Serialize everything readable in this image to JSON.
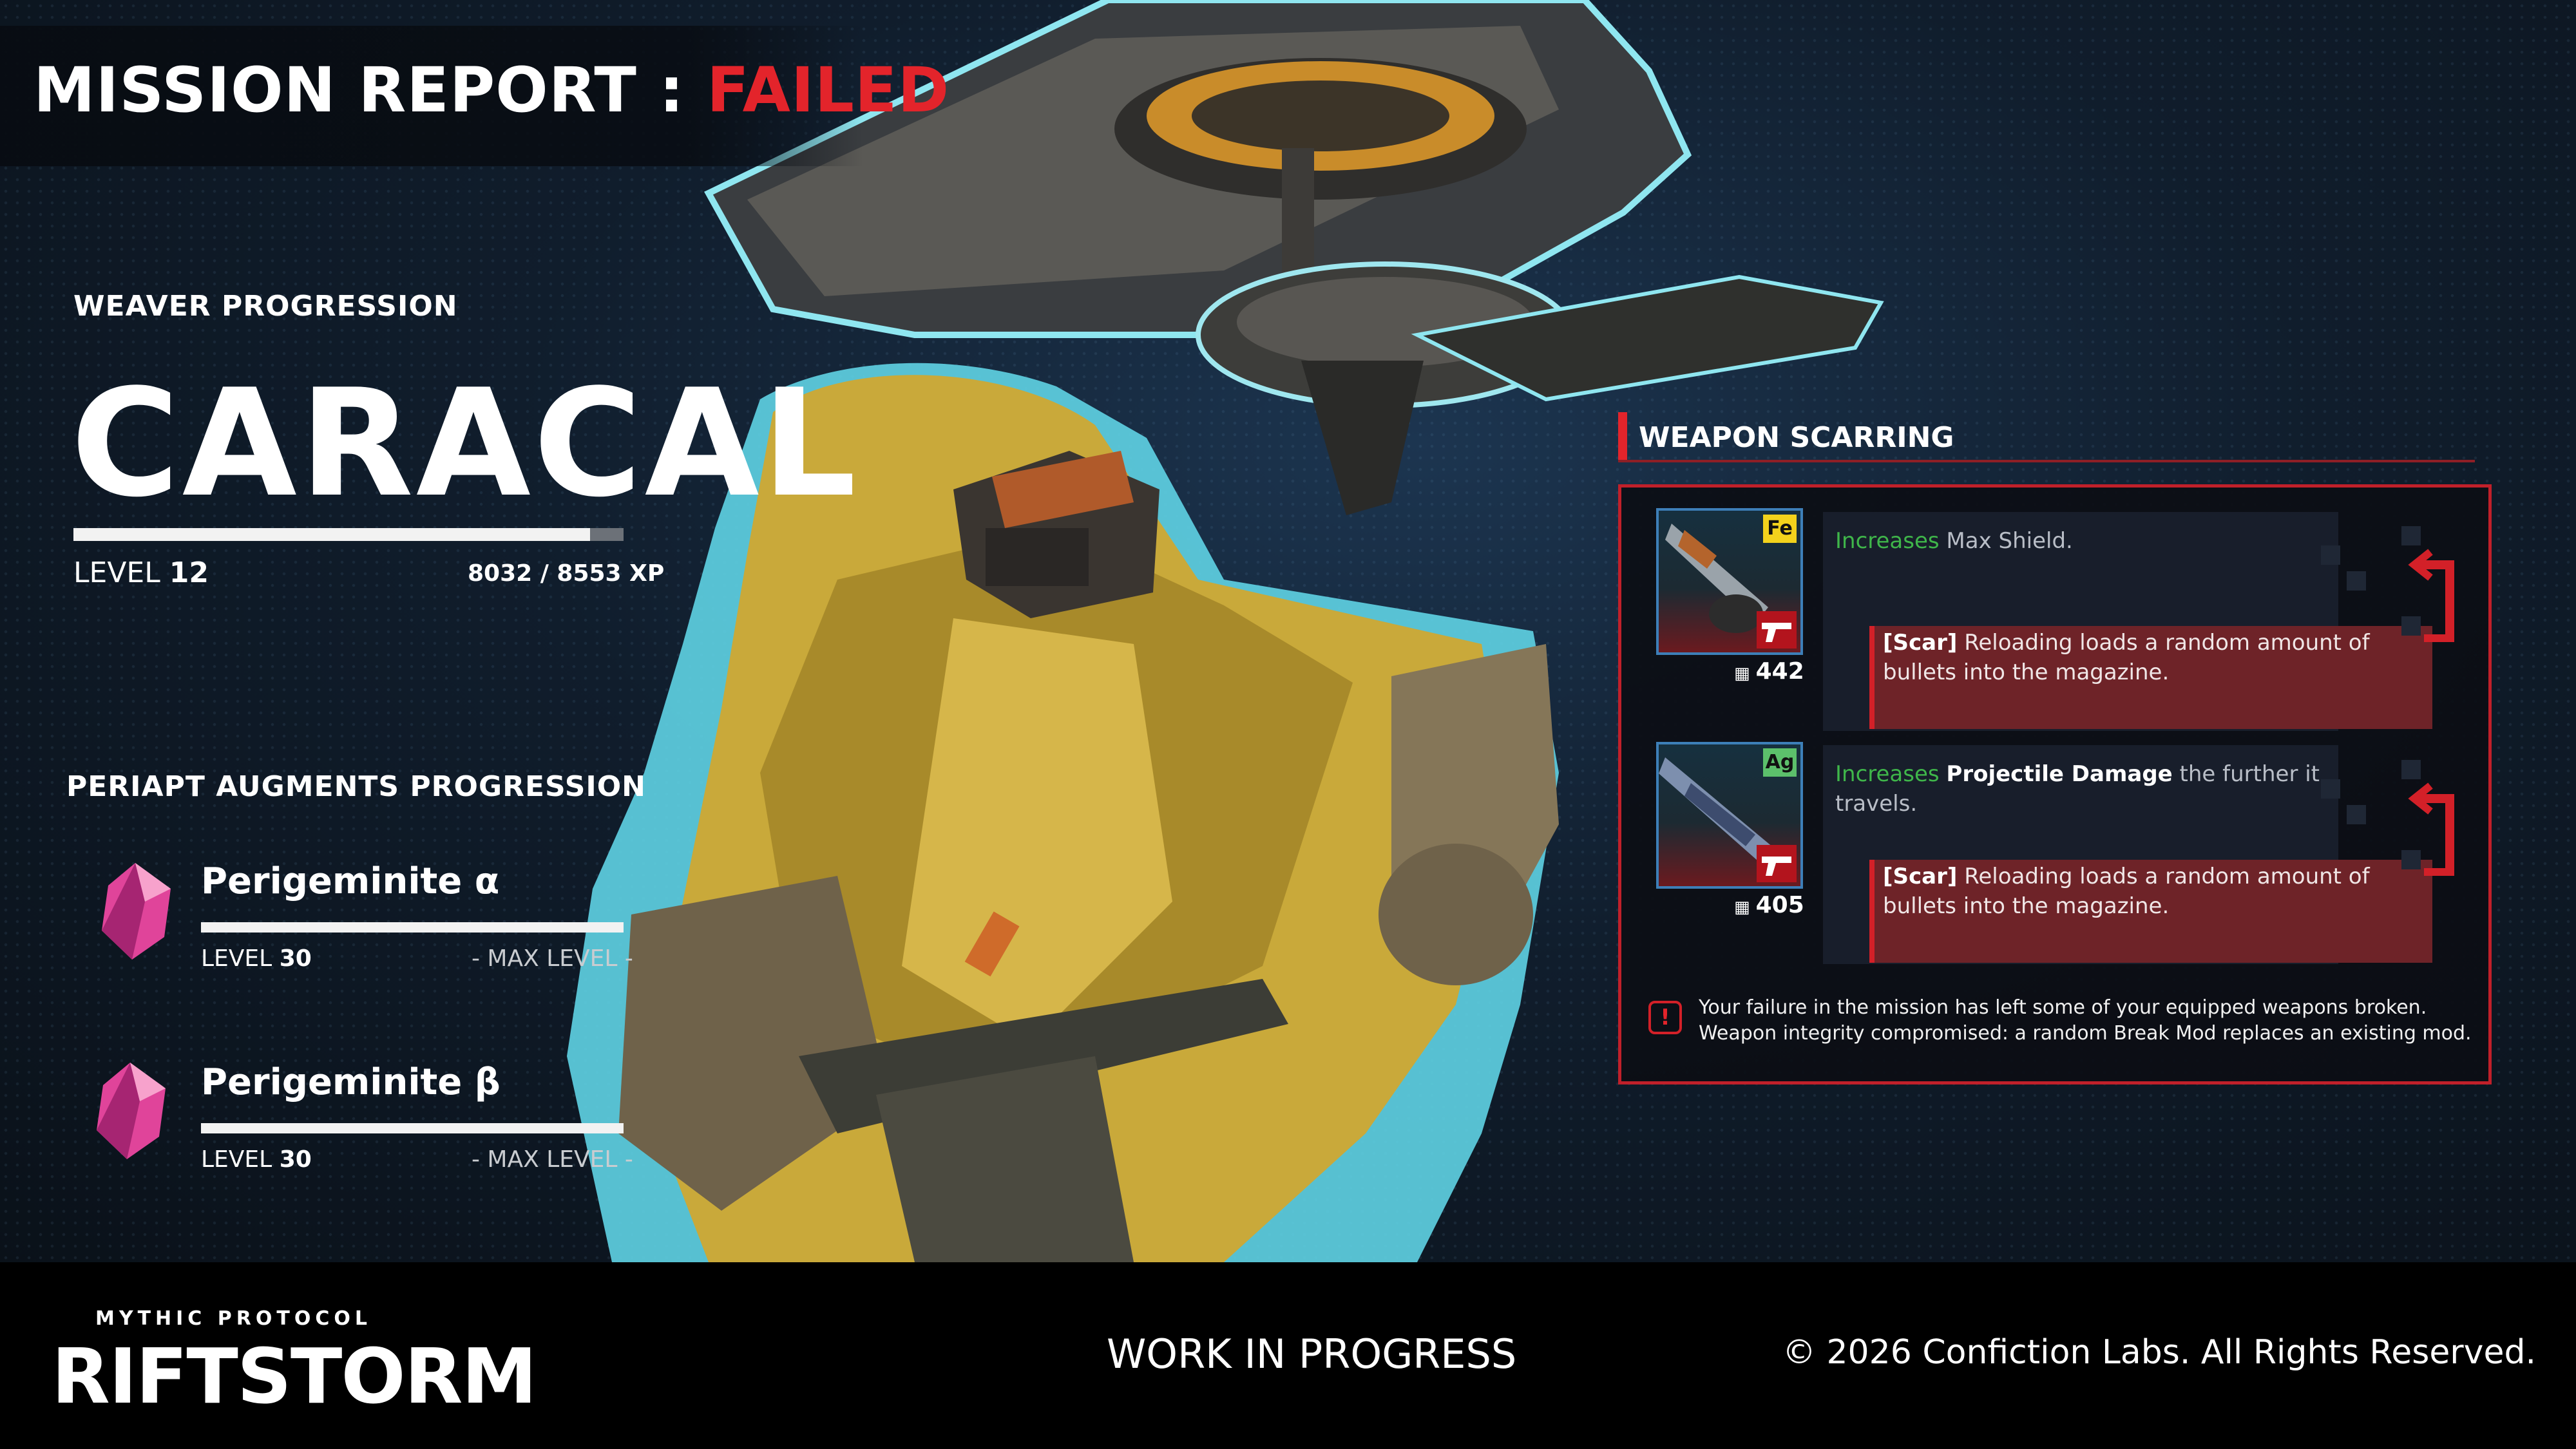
{
  "header": {
    "title_prefix": "MISSION REPORT :",
    "title_status": "FAILED"
  },
  "weaver": {
    "section_label": "WEAVER PROGRESSION",
    "name": "CARACAL",
    "level_label": "LEVEL",
    "level": "12",
    "xp_text": "8032 / 8553 XP",
    "xp_fraction": 0.939
  },
  "augments": {
    "section_label": "PERIAPT AUGMENTS PROGRESSION",
    "items": [
      {
        "name": "Perigeminite α",
        "level_label": "LEVEL",
        "level": "30",
        "status": "- MAX LEVEL -",
        "progress": 1.0
      },
      {
        "name": "Perigeminite β",
        "level_label": "LEVEL",
        "level": "30",
        "status": "- MAX LEVEL -",
        "progress": 1.0
      }
    ]
  },
  "weapon_scarring": {
    "title": "WEAPON SCARRING",
    "weapons": [
      {
        "element": "Fe",
        "element_color": "#f3d21c",
        "count": "442",
        "desc_green": "Increases",
        "desc_rest": " Max Shield.",
        "desc_bold": "",
        "desc_tail": "",
        "scar_tag": "[Scar]",
        "scar_text": " Reloading loads a random amount of bullets into the magazine."
      },
      {
        "element": "Ag",
        "element_color": "#5cc06b",
        "count": "405",
        "desc_green": "Increases",
        "desc_rest": " ",
        "desc_bold": "Projectile Damage",
        "desc_tail": " the further it travels.",
        "scar_tag": "[Scar]",
        "scar_text": " Reloading loads a random amount of bullets into the magazine."
      }
    ],
    "warning_icon": "!",
    "warning_line1": "Your failure in the mission has left some of your equipped weapons broken.",
    "warning_line2": "Weapon integrity compromised: a random Break Mod replaces an existing mod."
  },
  "footer": {
    "logo_sub": "MYTHIC PROTOCOL",
    "logo_main": "RIFTSTORM",
    "center": "WORK IN PROGRESS",
    "copyright": "© 2026 Confiction Labs. All Rights Reserved."
  },
  "colors": {
    "accent_red": "#e3242b",
    "panel_border": "#c0202a",
    "gem_pink": "#e0449a",
    "cloak_yellow": "#c9a93a"
  }
}
